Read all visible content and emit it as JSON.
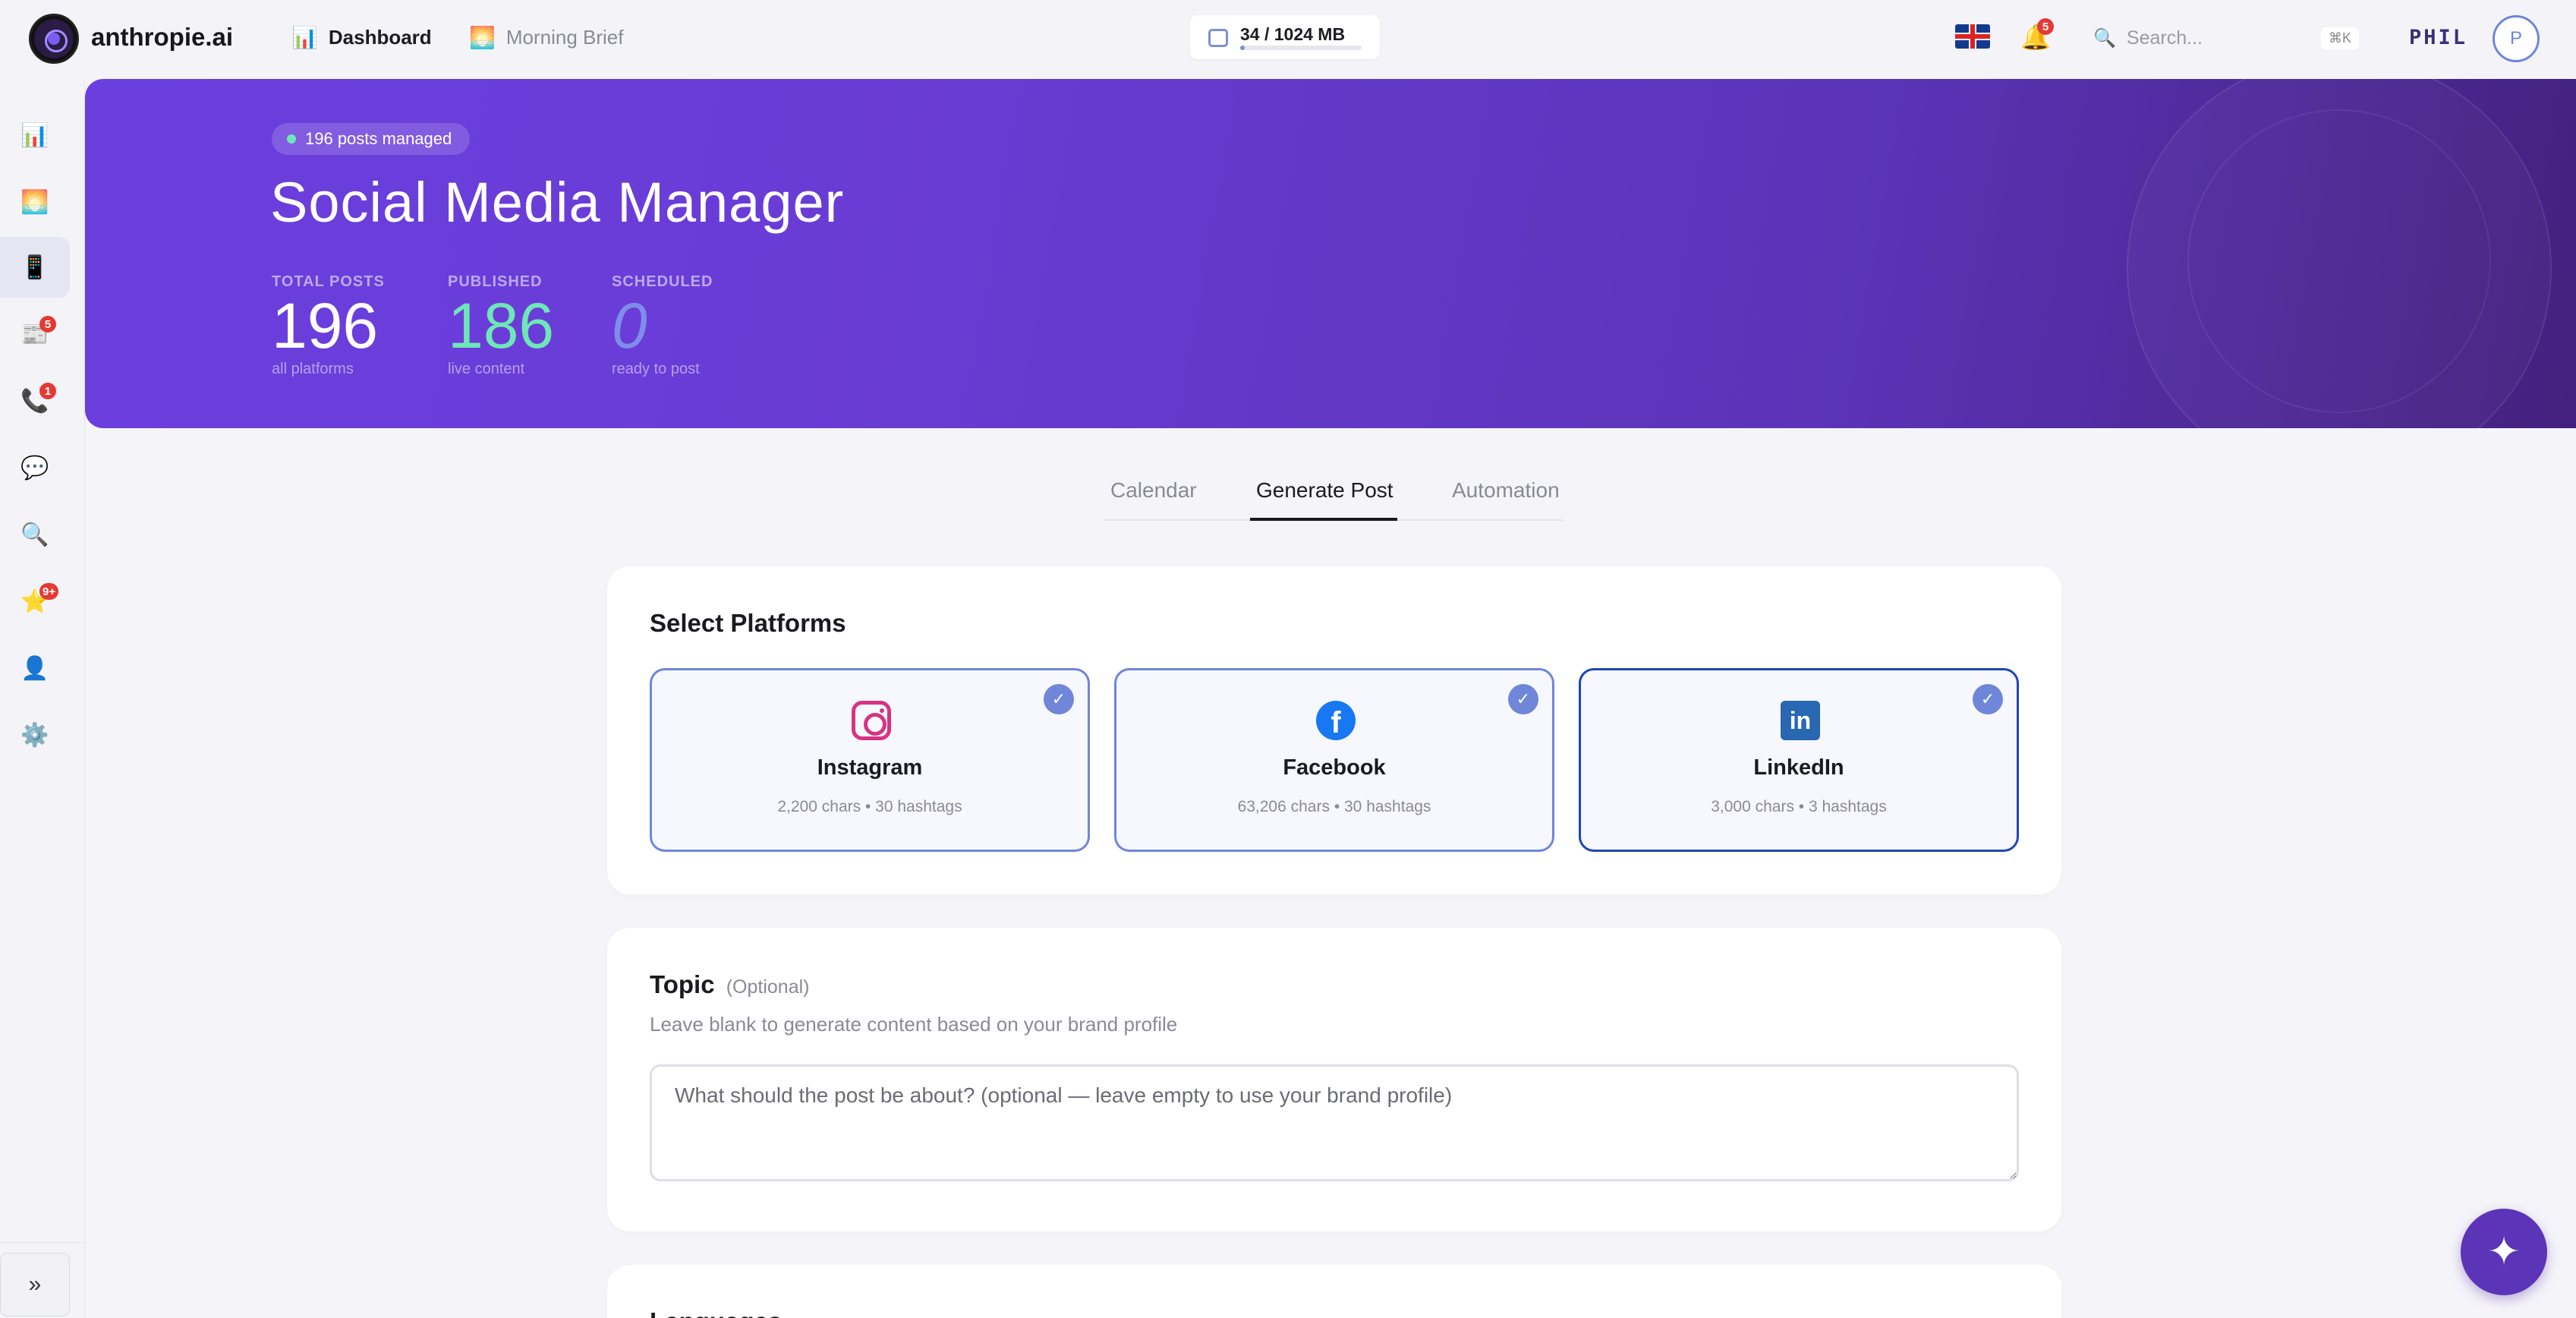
{
  "app": {
    "title": "anthropie.ai"
  },
  "nav": {
    "dashboard": {
      "label": "Dashboard",
      "icon": "bar-chart-icon"
    },
    "morning_brief": {
      "label": "Morning Brief",
      "icon": "sunrise-icon"
    }
  },
  "storage": {
    "label": "34 / 1024 MB",
    "used": 34,
    "total": 1024
  },
  "notifications": {
    "count": "5"
  },
  "search": {
    "placeholder": "Search...",
    "shortcut": "⌘K"
  },
  "user": {
    "name": "PHIL",
    "initial": "P"
  },
  "sidebar": {
    "items": [
      {
        "name": "analytics",
        "icon": "📊",
        "badge": ""
      },
      {
        "name": "brief",
        "icon": "🌅",
        "badge": ""
      },
      {
        "name": "social",
        "icon": "📱",
        "badge": "",
        "active": true
      },
      {
        "name": "news",
        "icon": "📰",
        "badge": "5"
      },
      {
        "name": "calls",
        "icon": "📞",
        "badge": "1"
      },
      {
        "name": "chat",
        "icon": "💬",
        "badge": ""
      },
      {
        "name": "search",
        "icon": "🔍",
        "badge": ""
      },
      {
        "name": "favorites",
        "icon": "⭐",
        "badge": "9+"
      },
      {
        "name": "profile",
        "icon": "👤",
        "badge": ""
      },
      {
        "name": "settings",
        "icon": "⚙️",
        "badge": ""
      }
    ],
    "expand_label": "»"
  },
  "hero": {
    "pill": "196 posts managed",
    "title": "Social Media Manager",
    "stats": {
      "total": {
        "label": "TOTAL POSTS",
        "value": "196",
        "sub": "all platforms"
      },
      "published": {
        "label": "PUBLISHED",
        "value": "186",
        "sub": "live content"
      },
      "scheduled": {
        "label": "SCHEDULED",
        "value": "0",
        "sub": "ready to post"
      }
    }
  },
  "tabs": {
    "calendar": "Calendar",
    "generate": "Generate Post",
    "automation": "Automation",
    "active": "Generate Post"
  },
  "platforms": {
    "title": "Select Platforms",
    "items": {
      "instagram": {
        "name": "Instagram",
        "info": "2,200 chars • 30 hashtags",
        "selected": true
      },
      "facebook": {
        "name": "Facebook",
        "info": "63,206 chars • 30 hashtags",
        "selected": true
      },
      "linkedin": {
        "name": "LinkedIn",
        "info": "3,000 chars • 3 hashtags",
        "selected": true
      }
    },
    "check": "✓"
  },
  "topic": {
    "title": "Topic",
    "optional": "(Optional)",
    "help": "Leave blank to generate content based on your brand profile",
    "placeholder": "What should the post be about? (optional — leave empty to use your brand profile)",
    "value": ""
  },
  "languages": {
    "title": "Languages"
  },
  "fab": {
    "icon": "sparkle-icon"
  },
  "colors": {
    "accent": "#6b3fde",
    "published": "#6ee7b7",
    "selection": "#6f86d9"
  }
}
